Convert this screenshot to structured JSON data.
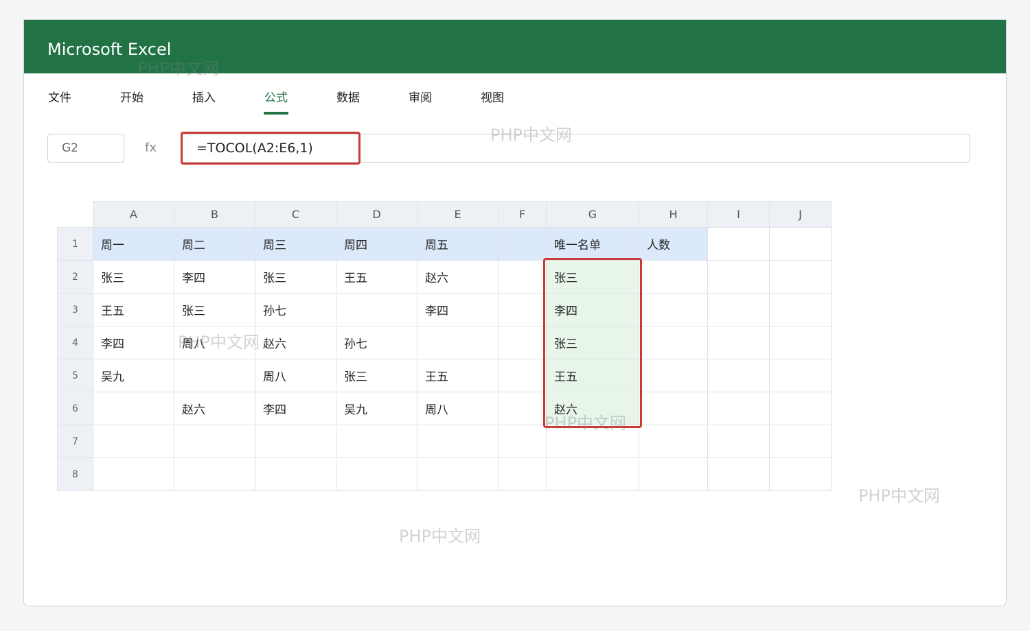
{
  "window": {
    "title": "Microsoft Excel"
  },
  "ribbon": {
    "tabs": [
      {
        "label": "文件"
      },
      {
        "label": "开始"
      },
      {
        "label": "插入"
      },
      {
        "label": "公式",
        "active": true
      },
      {
        "label": "数据"
      },
      {
        "label": "审阅"
      },
      {
        "label": "视图"
      }
    ]
  },
  "formula_bar": {
    "name_box": "G2",
    "fx_label": "fx",
    "formula": "=TOCOL(A2:E6,1)"
  },
  "sheet": {
    "columns": [
      "A",
      "B",
      "C",
      "D",
      "E",
      "F",
      "G",
      "H",
      "I",
      "J"
    ],
    "rows": [
      {
        "num": "1",
        "cells": [
          "周一",
          "周二",
          "周三",
          "周四",
          "周五",
          "",
          "唯一名单",
          "人数",
          "",
          ""
        ]
      },
      {
        "num": "2",
        "cells": [
          "张三",
          "李四",
          "张三",
          "王五",
          "赵六",
          "",
          "张三",
          "",
          "",
          ""
        ]
      },
      {
        "num": "3",
        "cells": [
          "王五",
          "张三",
          "孙七",
          "",
          "李四",
          "",
          "李四",
          "",
          "",
          ""
        ]
      },
      {
        "num": "4",
        "cells": [
          "李四",
          "周八",
          "赵六",
          "孙七",
          "",
          "",
          "张三",
          "",
          "",
          ""
        ]
      },
      {
        "num": "5",
        "cells": [
          "吴九",
          "",
          "周八",
          "张三",
          "王五",
          "",
          "王五",
          "",
          "",
          ""
        ]
      },
      {
        "num": "6",
        "cells": [
          "",
          "赵六",
          "李四",
          "吴九",
          "周八",
          "",
          "赵六",
          "",
          "",
          ""
        ]
      },
      {
        "num": "7",
        "cells": [
          "",
          "",
          "",
          "",
          "",
          "",
          "",
          "",
          "",
          ""
        ]
      },
      {
        "num": "8",
        "cells": [
          "",
          "",
          "",
          "",
          "",
          "",
          "",
          "",
          "",
          ""
        ]
      }
    ]
  },
  "watermark_text": "PHP中文网",
  "colors": {
    "brand": "#217346",
    "highlight_border": "#c83a33",
    "header_fill": "#dce9fb",
    "result_fill": "#e8f6e9"
  }
}
